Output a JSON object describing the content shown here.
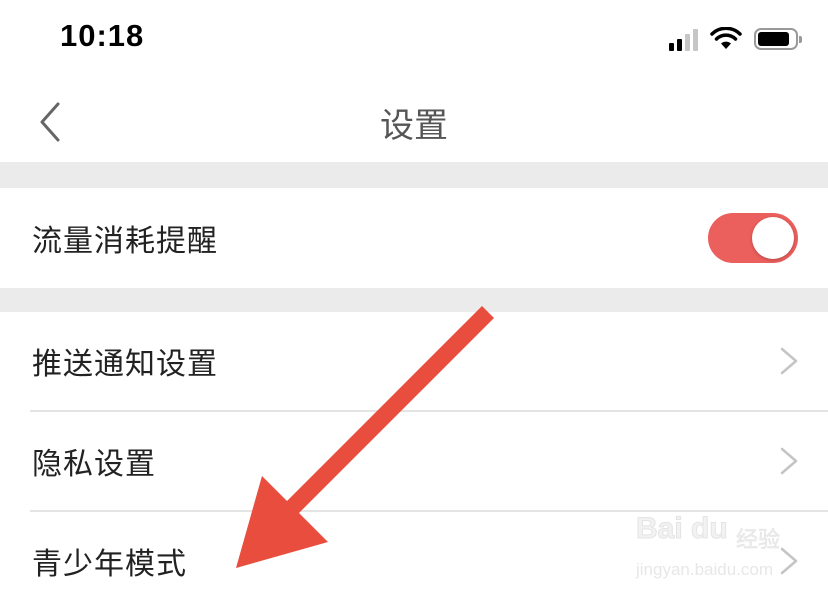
{
  "status_bar": {
    "time": "10:18",
    "signal_icon": "cellular-signal-icon",
    "wifi_icon": "wifi-icon",
    "battery_icon": "battery-icon"
  },
  "nav": {
    "back_icon": "chevron-left-icon",
    "title": "设置"
  },
  "settings": {
    "data_alert": {
      "label": "流量消耗提醒",
      "enabled": true
    },
    "items": [
      {
        "label": "推送通知设置",
        "icon": "chevron-right-icon"
      },
      {
        "label": "隐私设置",
        "icon": "chevron-right-icon"
      },
      {
        "label": "青少年模式",
        "icon": "chevron-right-icon"
      }
    ]
  },
  "colors": {
    "toggle_on": "#eb5f5c",
    "arrow": "#e84d3d",
    "section_gap": "#ebebeb",
    "chevron": "#c4c4c4"
  },
  "watermark": {
    "logo": "Bai du",
    "label": "经验",
    "url": "jingyan.baidu.com"
  }
}
